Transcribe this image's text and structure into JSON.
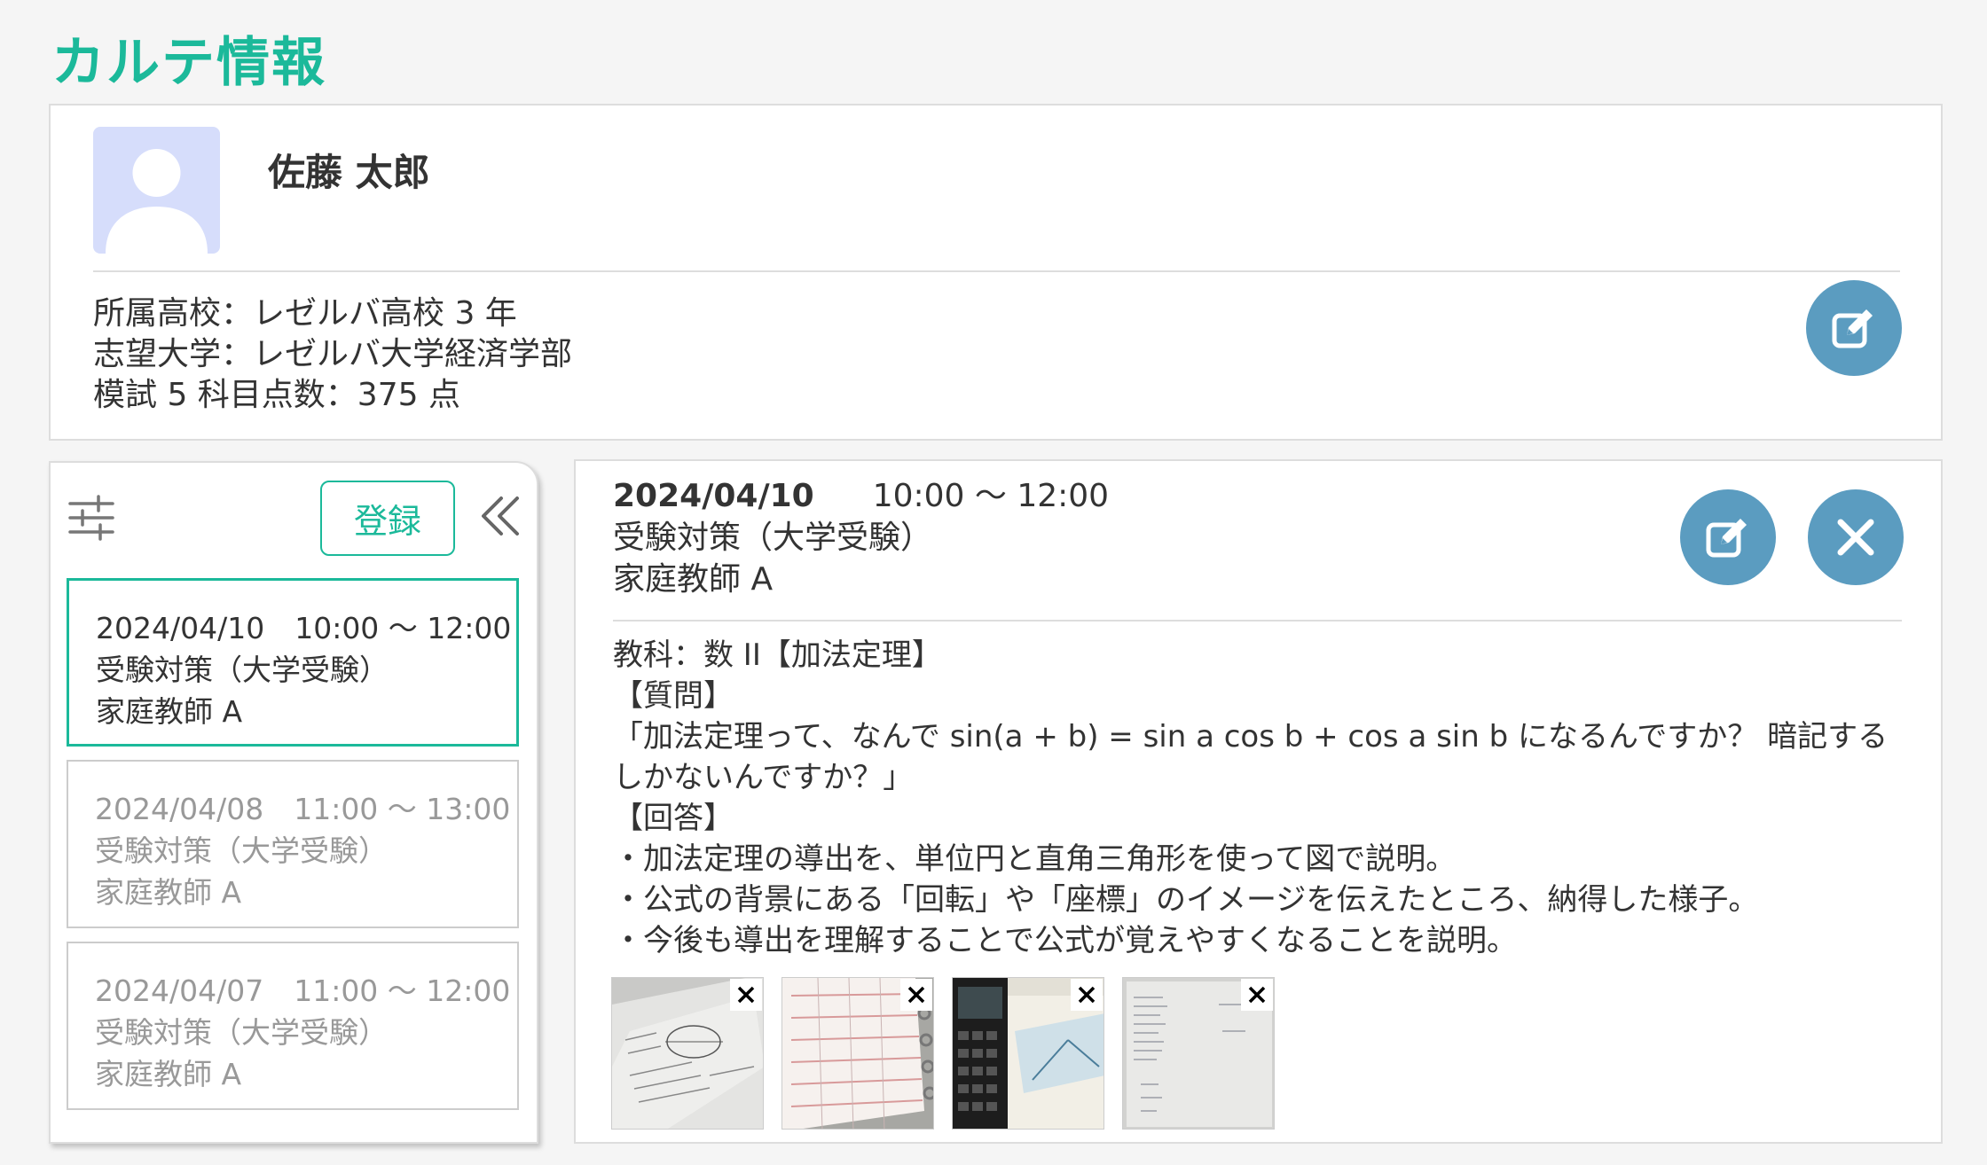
{
  "page": {
    "title": "カルテ情報"
  },
  "profile": {
    "name": "佐藤 太郎",
    "info": [
      "所属高校：レゼルバ高校 3 年",
      "志望大学：レゼルバ大学経済学部",
      "模試 5 科目点数：375 点"
    ]
  },
  "list": {
    "register_label": "登録",
    "items": [
      {
        "date": "2024/04/10",
        "time": "10:00 〜 12:00",
        "course": "受験対策（大学受験）",
        "tutor": "家庭教師 A",
        "active": true
      },
      {
        "date": "2024/04/08",
        "time": "11:00 〜 13:00",
        "course": "受験対策（大学受験）",
        "tutor": "家庭教師 A",
        "active": false
      },
      {
        "date": "2024/04/07",
        "time": "11:00 〜 12:00",
        "course": "受験対策（大学受験）",
        "tutor": "家庭教師 A",
        "active": false
      }
    ]
  },
  "detail": {
    "date": "2024/04/10",
    "time": "10:00 〜 12:00",
    "course": "受験対策（大学受験）",
    "tutor": "家庭教師 A",
    "body": [
      "教科：数 II【加法定理】",
      "【質問】",
      "「加法定理って、なんで sin(a + b) = sin a cos b + cos a sin b になるんですか？ 暗記するしかないんですか？」",
      "【回答】",
      "・加法定理の導出を、単位円と直角三角形を使って図で説明。",
      "・公式の背景にある「回転」や「座標」のイメージを伝えたところ、納得した様子。",
      "・今後も導出を理解することで公式が覚えやすくなることを説明。"
    ],
    "attachments": [
      {
        "icon": "notebook-diagram-photo"
      },
      {
        "icon": "planner-notebook-photo"
      },
      {
        "icon": "calculator-textbook-photo"
      },
      {
        "icon": "handwritten-notes-photo"
      }
    ]
  },
  "colors": {
    "accent": "#1bb99a",
    "action_button": "#5b9cc0",
    "avatar_bg": "#d6ddfb"
  }
}
